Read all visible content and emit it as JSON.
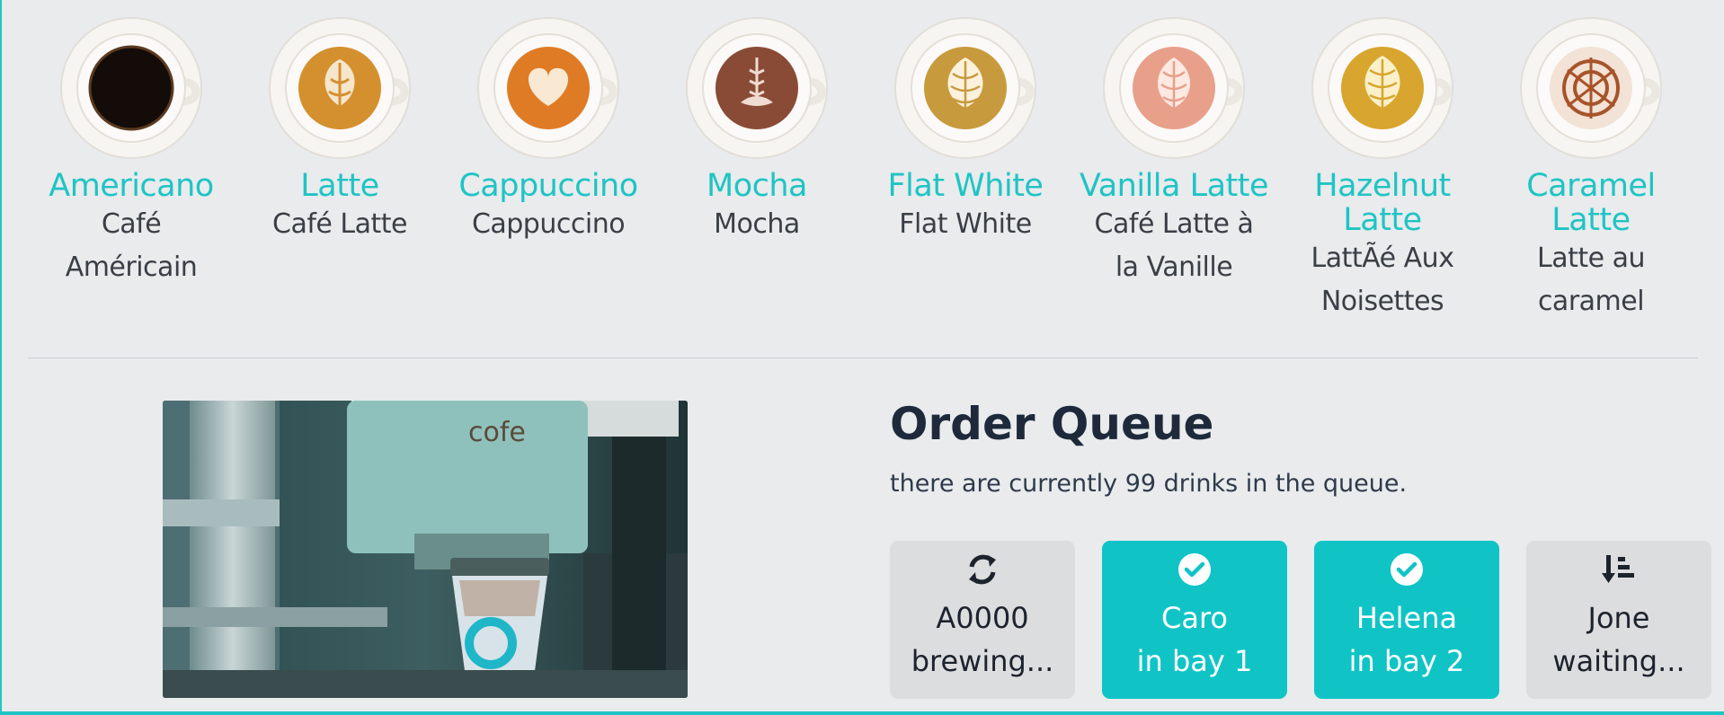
{
  "menu": {
    "drinks": [
      {
        "name": "Americano",
        "subtitle_line1": "Café",
        "subtitle_line2": "Américain",
        "icon": "americano-cup-icon"
      },
      {
        "name": "Latte",
        "subtitle_line1": "Café Latte",
        "subtitle_line2": "",
        "icon": "latte-cup-icon"
      },
      {
        "name": "Cappuccino",
        "subtitle_line1": "Cappuccino",
        "subtitle_line2": "",
        "icon": "cappuccino-cup-icon"
      },
      {
        "name": "Mocha",
        "subtitle_line1": "Mocha",
        "subtitle_line2": "",
        "icon": "mocha-cup-icon"
      },
      {
        "name": "Flat White",
        "subtitle_line1": "Flat White",
        "subtitle_line2": "",
        "icon": "flat-white-cup-icon"
      },
      {
        "name": "Vanilla Latte",
        "subtitle_line1": "Café Latte à",
        "subtitle_line2": "la Vanille",
        "icon": "vanilla-latte-cup-icon"
      },
      {
        "name_line1": "Hazelnut",
        "name_line2": "Latte",
        "subtitle_line1": "LattÃé Aux",
        "subtitle_line2": "Noisettes",
        "icon": "hazelnut-latte-cup-icon"
      },
      {
        "name_line1": "Caramel",
        "name_line2": "Latte",
        "subtitle_line1": "Latte au",
        "subtitle_line2": "caramel",
        "icon": "caramel-latte-cup-icon"
      }
    ]
  },
  "camera": {
    "brand_text": "cofe"
  },
  "queue": {
    "title": "Order Queue",
    "count_text": "there are currently 99 drinks in the queue.",
    "orders": [
      {
        "line1": "A0000",
        "line2": "brewing...",
        "status": "brewing",
        "icon": "refresh-icon"
      },
      {
        "line1": "Caro",
        "line2": "in bay 1",
        "status": "ready",
        "icon": "check-circle-icon"
      },
      {
        "line1": "Helena",
        "line2": "in bay 2",
        "status": "ready",
        "icon": "check-circle-icon"
      },
      {
        "line1": "Jone",
        "line2": "waiting...",
        "status": "waiting",
        "icon": "sort-amount-down-icon"
      }
    ]
  },
  "colors": {
    "accent": "#1fc4c4",
    "tile_ready": "#10c4c6",
    "tile_idle": "#dcdddf",
    "background": "#e9ebed",
    "heading": "#1e2a3b"
  }
}
